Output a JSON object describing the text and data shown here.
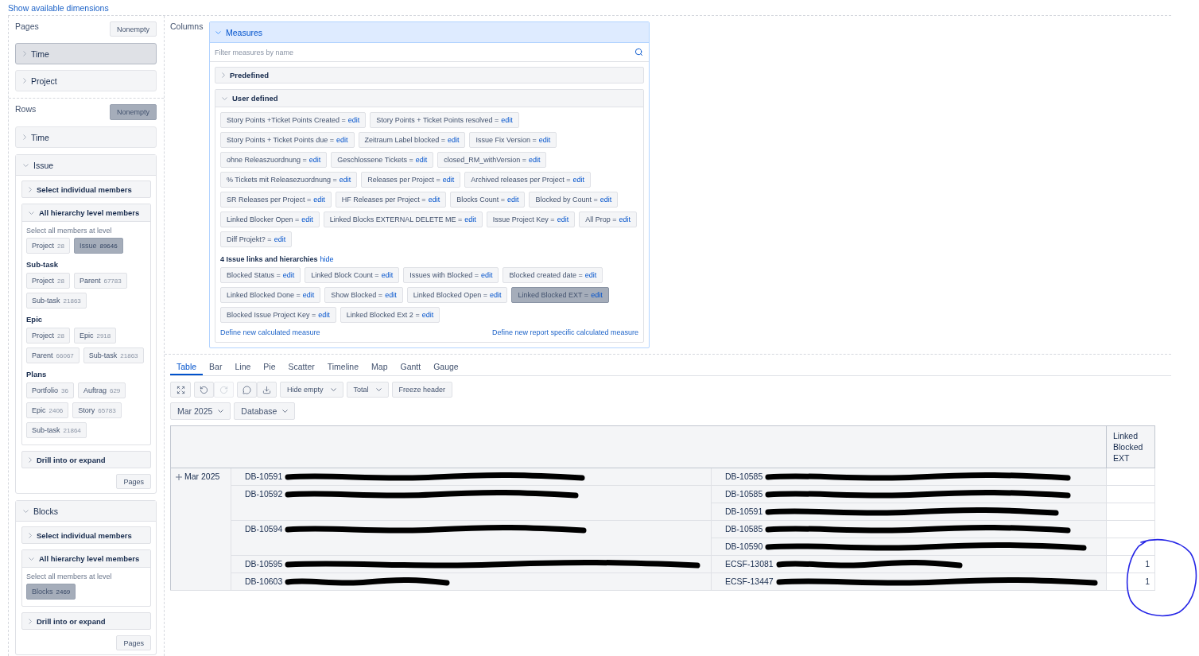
{
  "dimensions_link": "Show available dimensions",
  "pages": {
    "title": "Pages",
    "nonempty": {
      "label": "Nonempty",
      "selected": false
    },
    "items": [
      {
        "label": "Time",
        "selected": true,
        "expanded": false
      },
      {
        "label": "Project",
        "selected": false,
        "expanded": false
      }
    ]
  },
  "rows": {
    "title": "Rows",
    "nonempty": {
      "label": "Nonempty",
      "selected": true
    },
    "items": [
      {
        "label": "Time",
        "selected": false,
        "expanded": false
      },
      {
        "label": "Issue",
        "selected": false,
        "expanded": true,
        "sections": [
          {
            "label": "Select individual members",
            "expanded": false
          },
          {
            "label": "All hierarchy level members",
            "expanded": true,
            "hint": "Select all members at level",
            "levels": [
              {
                "chips": [
                  {
                    "label": "Project",
                    "count": "28",
                    "selected": false
                  },
                  {
                    "label": "Issue",
                    "count": "89646",
                    "selected": true
                  }
                ]
              },
              {
                "title": "Sub-task",
                "chips": [
                  {
                    "label": "Project",
                    "count": "28",
                    "selected": false
                  },
                  {
                    "label": "Parent",
                    "count": "67783",
                    "selected": false
                  },
                  {
                    "label": "Sub-task",
                    "count": "21863",
                    "selected": false
                  }
                ]
              },
              {
                "title": "Epic",
                "chips": [
                  {
                    "label": "Project",
                    "count": "28",
                    "selected": false
                  },
                  {
                    "label": "Epic",
                    "count": "2918",
                    "selected": false
                  },
                  {
                    "label": "Parent",
                    "count": "66067",
                    "selected": false
                  },
                  {
                    "label": "Sub-task",
                    "count": "21863",
                    "selected": false
                  }
                ]
              },
              {
                "title": "Plans",
                "chips": [
                  {
                    "label": "Portfolio",
                    "count": "36",
                    "selected": false
                  },
                  {
                    "label": "Auftrag",
                    "count": "629",
                    "selected": false
                  },
                  {
                    "label": "Epic",
                    "count": "2406",
                    "selected": false
                  },
                  {
                    "label": "Story",
                    "count": "65783",
                    "selected": false
                  },
                  {
                    "label": "Sub-task",
                    "count": "21864",
                    "selected": false
                  }
                ]
              }
            ]
          },
          {
            "label": "Drill into or expand",
            "expanded": false
          }
        ],
        "pages_button": "Pages"
      },
      {
        "label": "Blocks",
        "selected": false,
        "expanded": true,
        "sections": [
          {
            "label": "Select individual members",
            "expanded": false
          },
          {
            "label": "All hierarchy level members",
            "expanded": true,
            "hint": "Select all members at level",
            "levels": [
              {
                "chips": [
                  {
                    "label": "Blocks",
                    "count": "2469",
                    "selected": true
                  }
                ]
              }
            ]
          },
          {
            "label": "Drill into or expand",
            "expanded": false
          }
        ],
        "pages_button": "Pages"
      }
    ]
  },
  "columns": {
    "title": "Columns",
    "measures": {
      "title": "Measures",
      "expanded": true,
      "filter": {
        "placeholder": "Filter measures by name"
      },
      "groups": [
        {
          "label": "Predefined",
          "expanded": false
        },
        {
          "label": "User defined",
          "expanded": true,
          "measures": [
            {
              "label": "Story Points +Ticket Points Created =",
              "action": "edit",
              "selected": false
            },
            {
              "label": "Story Points + Ticket Points resolved =",
              "action": "edit",
              "selected": false
            },
            {
              "label": "Story Points + Ticket Points due =",
              "action": "edit",
              "selected": false
            },
            {
              "label": "Zeitraum Label blocked =",
              "action": "edit",
              "selected": false
            },
            {
              "label": "Issue Fix Version =",
              "action": "edit",
              "selected": false
            },
            {
              "label": "ohne Releaszuordnung =",
              "action": "edit",
              "selected": false
            },
            {
              "label": "Geschlossene Tickets =",
              "action": "edit",
              "selected": false
            },
            {
              "label": "closed_RM_withVersion =",
              "action": "edit",
              "selected": false
            },
            {
              "label": "% Tickets mit Releasezuordnung =",
              "action": "edit",
              "selected": false
            },
            {
              "label": "Releases per Project =",
              "action": "edit",
              "selected": false
            },
            {
              "label": "Archived releases per Project =",
              "action": "edit",
              "selected": false
            },
            {
              "label": "SR Releases per Project =",
              "action": "edit",
              "selected": false
            },
            {
              "label": "HF Releases per Project =",
              "action": "edit",
              "selected": false
            },
            {
              "label": "Blocks Count =",
              "action": "edit",
              "selected": false
            },
            {
              "label": "Blocked by Count =",
              "action": "edit",
              "selected": false
            },
            {
              "label": "Linked Blocker Open =",
              "action": "edit",
              "selected": false
            },
            {
              "label": "Linked Blocks EXTERNAL DELETE ME =",
              "action": "edit",
              "selected": false
            },
            {
              "label": "Issue Project Key =",
              "action": "edit",
              "selected": false
            },
            {
              "label": "All Prop =",
              "action": "edit",
              "selected": false
            },
            {
              "label": "Diff Projekt? =",
              "action": "edit",
              "selected": false
            }
          ],
          "subgroups": [
            {
              "title": "4 Issue links and hierarchies",
              "action": "hide",
              "measures": [
                {
                  "label": "Blocked Status =",
                  "action": "edit",
                  "selected": false
                },
                {
                  "label": "Linked Block Count =",
                  "action": "edit",
                  "selected": false
                },
                {
                  "label": "Issues with Blocked =",
                  "action": "edit",
                  "selected": false
                },
                {
                  "label": "Blocked created date =",
                  "action": "edit",
                  "selected": false
                },
                {
                  "label": "Linked Blocked Done =",
                  "action": "edit",
                  "selected": false
                },
                {
                  "label": "Show Blocked =",
                  "action": "edit",
                  "selected": false
                },
                {
                  "label": "Linked Blocked Open =",
                  "action": "edit",
                  "selected": false
                },
                {
                  "label": "Linked Blocked EXT =",
                  "action": "edit",
                  "selected": true
                },
                {
                  "label": "Blocked Issue Project Key =",
                  "action": "edit",
                  "selected": false
                },
                {
                  "label": "Linked Blocked Ext 2 =",
                  "action": "edit",
                  "selected": false
                }
              ]
            }
          ],
          "links": [
            "Define new calculated measure",
            "Define new report specific calculated measure"
          ]
        }
      ]
    }
  },
  "tabs": [
    {
      "label": "Table",
      "selected": true
    },
    {
      "label": "Bar",
      "selected": false
    },
    {
      "label": "Line",
      "selected": false
    },
    {
      "label": "Pie",
      "selected": false
    },
    {
      "label": "Scatter",
      "selected": false
    },
    {
      "label": "Timeline",
      "selected": false
    },
    {
      "label": "Map",
      "selected": false
    },
    {
      "label": "Gantt",
      "selected": false
    },
    {
      "label": "Gauge",
      "selected": false
    }
  ],
  "toolbar": [
    {
      "kind": "icons",
      "buttons": [
        {
          "disabled": false
        }
      ]
    },
    {
      "kind": "icons",
      "buttons": [
        {
          "disabled": false
        },
        {
          "disabled": true
        }
      ]
    },
    {
      "kind": "icons",
      "buttons": [
        {
          "disabled": false
        },
        {
          "disabled": false
        }
      ]
    },
    {
      "kind": "dropdown",
      "label": "Hide empty"
    },
    {
      "kind": "dropdown",
      "label": "Total"
    },
    {
      "kind": "button",
      "label": "Freeze header"
    }
  ],
  "filters": [
    {
      "label": "Mar 2025"
    },
    {
      "label": "Database"
    }
  ],
  "table": {
    "header": {
      "measure": "Linked Blocked EXT"
    },
    "period": {
      "label": "Mar 2025"
    },
    "issues": [
      {
        "key": "DB-10591",
        "redacted": true,
        "links": [
          {
            "key": "DB-10585",
            "redacted": true
          }
        ]
      },
      {
        "key": "DB-10592",
        "redacted": true,
        "links": [
          {
            "key": "DB-10585",
            "redacted": true
          },
          {
            "key": "DB-10591",
            "redacted": true
          }
        ]
      },
      {
        "key": "DB-10594",
        "redacted": true,
        "links": [
          {
            "key": "DB-10585",
            "redacted": true
          },
          {
            "key": "DB-10590",
            "redacted": true
          }
        ]
      },
      {
        "key": "DB-10595",
        "redacted": true,
        "links": [
          {
            "key": "ECSF-13081",
            "redacted": true,
            "value": "1"
          }
        ]
      },
      {
        "key": "DB-10603",
        "redacted": true,
        "links": [
          {
            "key": "ECSF-13447",
            "redacted": true,
            "value": "1"
          }
        ]
      }
    ]
  }
}
